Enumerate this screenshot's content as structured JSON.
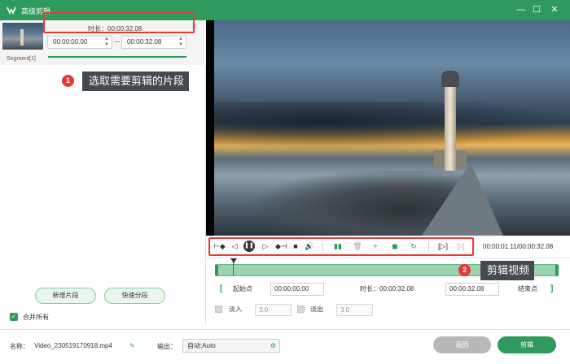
{
  "window": {
    "title": "高级剪辑",
    "minimize": "—",
    "maximize": "☐",
    "close": "✕"
  },
  "segment": {
    "duration_label": "时长：00:00:32.08",
    "start": "00:00:00.00",
    "end": "00:00:32.08",
    "label": "Segment[1]"
  },
  "annotations": [
    {
      "number": "1",
      "text": "选取需要剪辑的片段"
    },
    {
      "number": "2",
      "text": "剪辑视频"
    }
  ],
  "left_buttons": {
    "new_segment": "新增片段",
    "quick_split": "快速分段"
  },
  "merge_all": {
    "label": "合并所有",
    "checked": true
  },
  "player": {
    "time_readout": "00:00:01.11/00:00:32.08"
  },
  "edit": {
    "start_label": "起始点",
    "start_value": "00:00:00.00",
    "duration_label": "时长：00:00:32.08",
    "end_value": "00:00:32.08",
    "end_label": "结束点"
  },
  "fade": {
    "fade_in_label": "淡入",
    "fade_in_value": "3.0",
    "fade_out_label": "淡出",
    "fade_out_value": "3.0"
  },
  "bottom": {
    "name_label": "名称：",
    "file_name": "Video_230519170918.mp4",
    "output_label": "输出：",
    "output_value": "自动;Auto",
    "back_button": "返回",
    "cut_button": "剪辑"
  },
  "colors": {
    "accent": "#2e9a5d",
    "annotation_red": "#e63b35",
    "callout_bg": "#444a4f"
  }
}
